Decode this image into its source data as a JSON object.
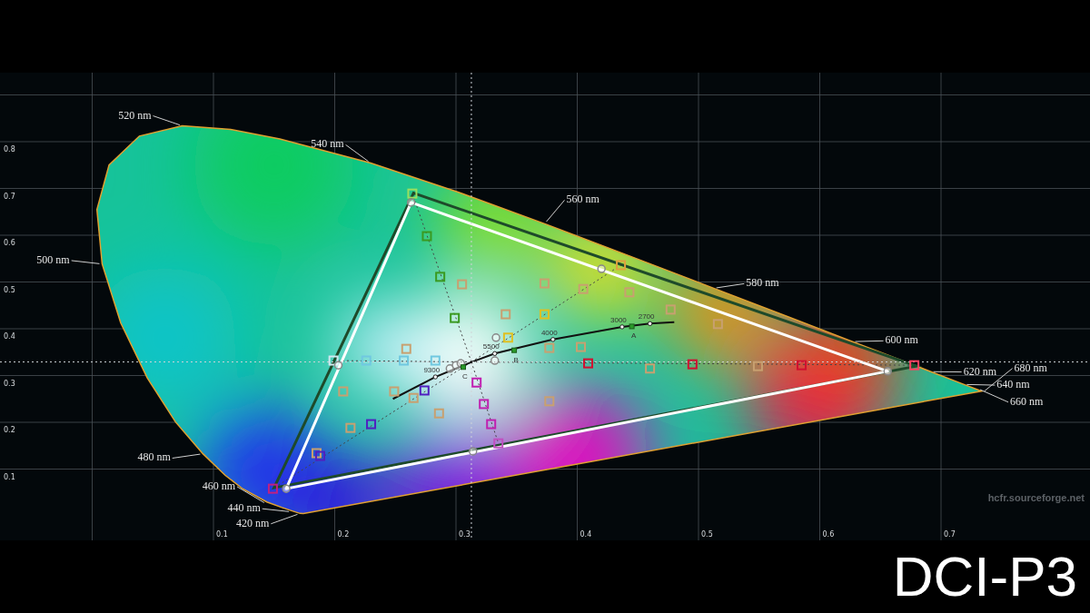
{
  "diagram": {
    "y_axis_labels": [
      "0.8",
      "0.7",
      "0.6",
      "0.5",
      "0.4",
      "0.3",
      "0.2",
      "0.1"
    ],
    "x_axis_labels": [
      "0.1",
      "0.2",
      "0.3",
      "0.4",
      "0.5",
      "0.6",
      "0.7"
    ],
    "wavelength_labels": [
      "520 nm",
      "540 nm",
      "560 nm",
      "580 nm",
      "600 nm",
      "500 nm",
      "620 nm",
      "640 nm",
      "660 nm",
      "680 nm",
      "480 nm",
      "460 nm",
      "440 nm",
      "420 nm"
    ],
    "temperature_labels": [
      "3000",
      "2700",
      "4000",
      "5500",
      "9300"
    ],
    "illuminant_labels": [
      "A",
      "B",
      "C"
    ],
    "credit": "hcfr.sourceforge.net"
  },
  "caption": "DCI-P3"
}
